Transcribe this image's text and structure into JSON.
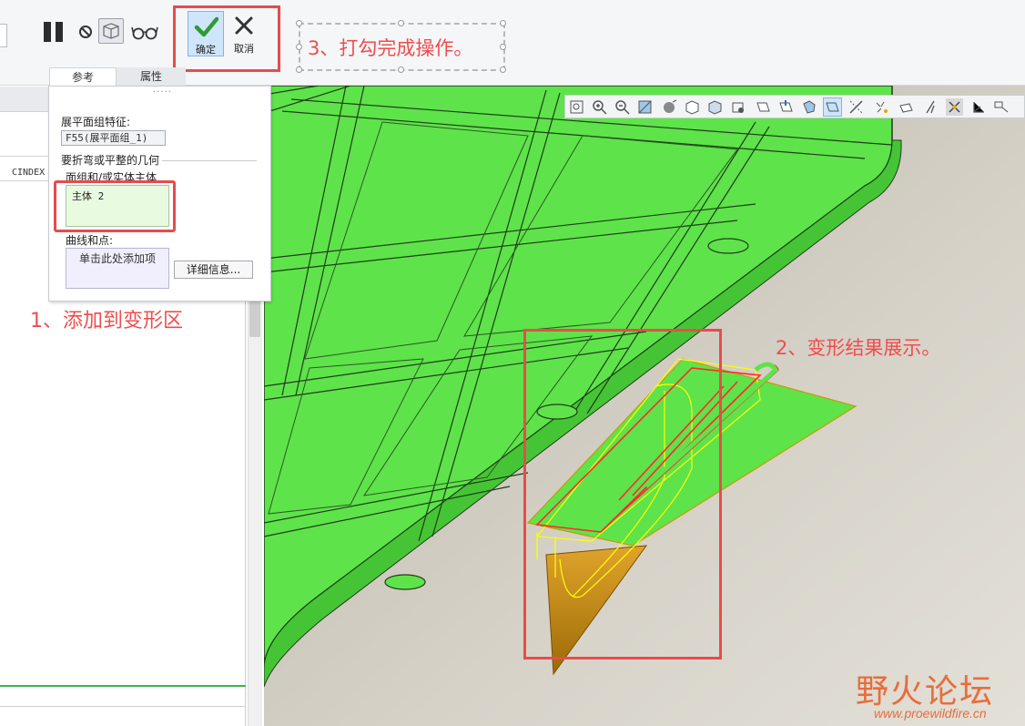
{
  "ribbon": {
    "ok_label": "确定",
    "cancel_label": "取消"
  },
  "tabs": {
    "references": "参考",
    "properties": "属性"
  },
  "left_panel": {
    "column_header": "CINDEX"
  },
  "reference_panel": {
    "flatten_feature_label": "展平面组特征:",
    "flatten_feature_value": "F55(展平面组_1)",
    "geometry_section_label": "要折弯或平整的几何",
    "quilt_label": "面组和/或实体主体",
    "quilt_items": [
      "主体 2"
    ],
    "curves_label": "曲线和点:",
    "curves_placeholder": "单击此处添加项",
    "details_button": "详细信息..."
  },
  "annotations": {
    "step1": "1、添加到变形区",
    "step2": "2、变形结果展示。",
    "step3": "3、打勾完成操作。"
  },
  "watermark": {
    "title": "野火论坛",
    "url": "www.proewildfire.cn"
  },
  "colors": {
    "annotation_red": "#e74c4c",
    "model_green": "#5ee34a",
    "surface_orange": "#c98a10",
    "background_gray": "#cdc8bd"
  }
}
